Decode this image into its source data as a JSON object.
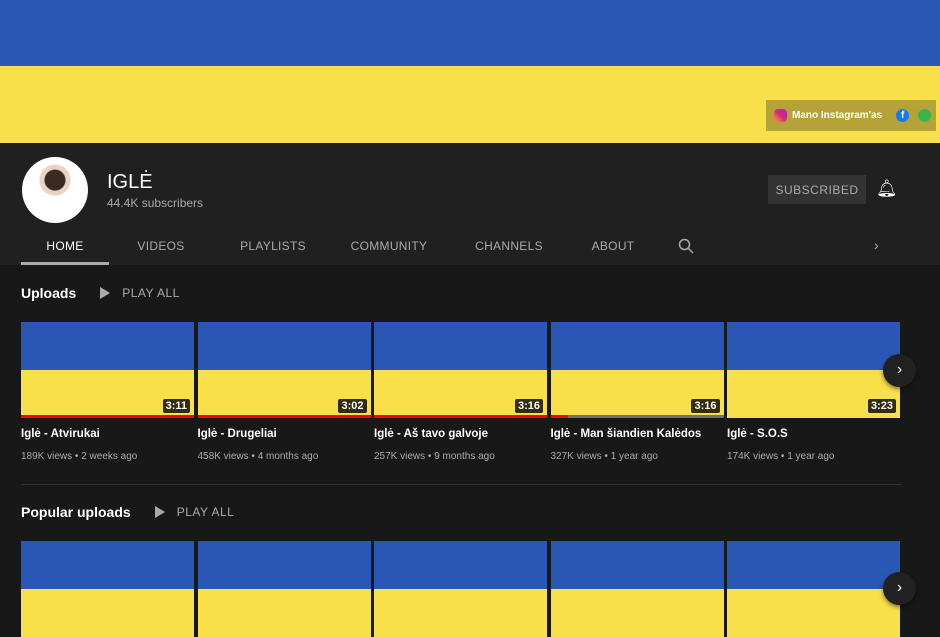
{
  "colors": {
    "banner_blue": "#2a57b6",
    "banner_yellow": "#f9df4a",
    "progress": "#ff0000"
  },
  "banner": {
    "links": [
      {
        "icon": "instagram-icon",
        "label": "Mano Instagram'as"
      },
      {
        "icon": "facebook-icon",
        "label": "f"
      },
      {
        "icon": "spotify-icon"
      }
    ]
  },
  "channel": {
    "name": "IGLĖ",
    "subscribers": "44.4K subscribers",
    "subscribe_label": "SUBSCRIBED",
    "bell_icon": "bell-icon"
  },
  "tabs": [
    "HOME",
    "VIDEOS",
    "PLAYLISTS",
    "COMMUNITY",
    "CHANNELS",
    "ABOUT"
  ],
  "uploads": {
    "title": "Uploads",
    "play_all": "PLAY ALL",
    "videos": [
      {
        "title": "Iglė - Atvirukai",
        "meta": "189K views • 2 weeks ago",
        "duration": "3:11",
        "progress": 100
      },
      {
        "title": "Iglė - Drugeliai",
        "meta": "458K views • 4 months ago",
        "duration": "3:02",
        "progress": 100
      },
      {
        "title": "Iglė - Aš tavo galvoje",
        "meta": "257K views • 9 months ago",
        "duration": "3:16",
        "progress": 100
      },
      {
        "title": "Iglė - Man šiandien Kalėdos",
        "meta": "327K views • 1 year ago",
        "duration": "3:16",
        "progress": 10
      },
      {
        "title": "Iglė - S.O.S",
        "meta": "174K views • 1 year ago",
        "duration": "3:23",
        "progress": 0
      }
    ]
  },
  "popular": {
    "title": "Popular uploads",
    "play_all": "PLAY ALL"
  }
}
